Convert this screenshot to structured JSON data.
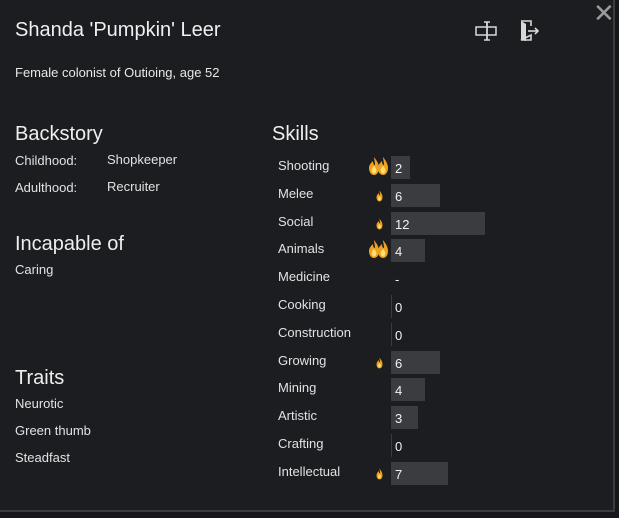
{
  "header": {
    "name": "Shanda 'Pumpkin' Leer",
    "description": "Female colonist of Outioing, age 52",
    "rename_icon": "rename-icon",
    "banish_icon": "banish-icon",
    "close_icon": "close-icon",
    "close_glyph": "✕"
  },
  "backstory": {
    "heading": "Backstory",
    "childhood_label": "Childhood:",
    "childhood_value": "Shopkeeper",
    "adulthood_label": "Adulthood:",
    "adulthood_value": "Recruiter"
  },
  "incapable": {
    "heading": "Incapable of",
    "items": [
      "Caring"
    ]
  },
  "traits": {
    "heading": "Traits",
    "items": [
      "Neurotic",
      "Green thumb",
      "Steadfast"
    ]
  },
  "skills": {
    "heading": "Skills",
    "max_level": 20,
    "items": [
      {
        "name": "Shooting",
        "level": "2",
        "passion": "major"
      },
      {
        "name": "Melee",
        "level": "6",
        "passion": "minor"
      },
      {
        "name": "Social",
        "level": "12",
        "passion": "minor"
      },
      {
        "name": "Animals",
        "level": "4",
        "passion": "major"
      },
      {
        "name": "Medicine",
        "level": "-",
        "passion": "none"
      },
      {
        "name": "Cooking",
        "level": "0",
        "passion": "none"
      },
      {
        "name": "Construction",
        "level": "0",
        "passion": "none"
      },
      {
        "name": "Growing",
        "level": "6",
        "passion": "minor"
      },
      {
        "name": "Mining",
        "level": "4",
        "passion": "none"
      },
      {
        "name": "Artistic",
        "level": "3",
        "passion": "none"
      },
      {
        "name": "Crafting",
        "level": "0",
        "passion": "none"
      },
      {
        "name": "Intellectual",
        "level": "7",
        "passion": "minor"
      }
    ]
  },
  "colors": {
    "background": "#1b1d20",
    "bar": "#3a3c40",
    "flame_outer": "#f0a020",
    "flame_inner": "#ffe070"
  }
}
